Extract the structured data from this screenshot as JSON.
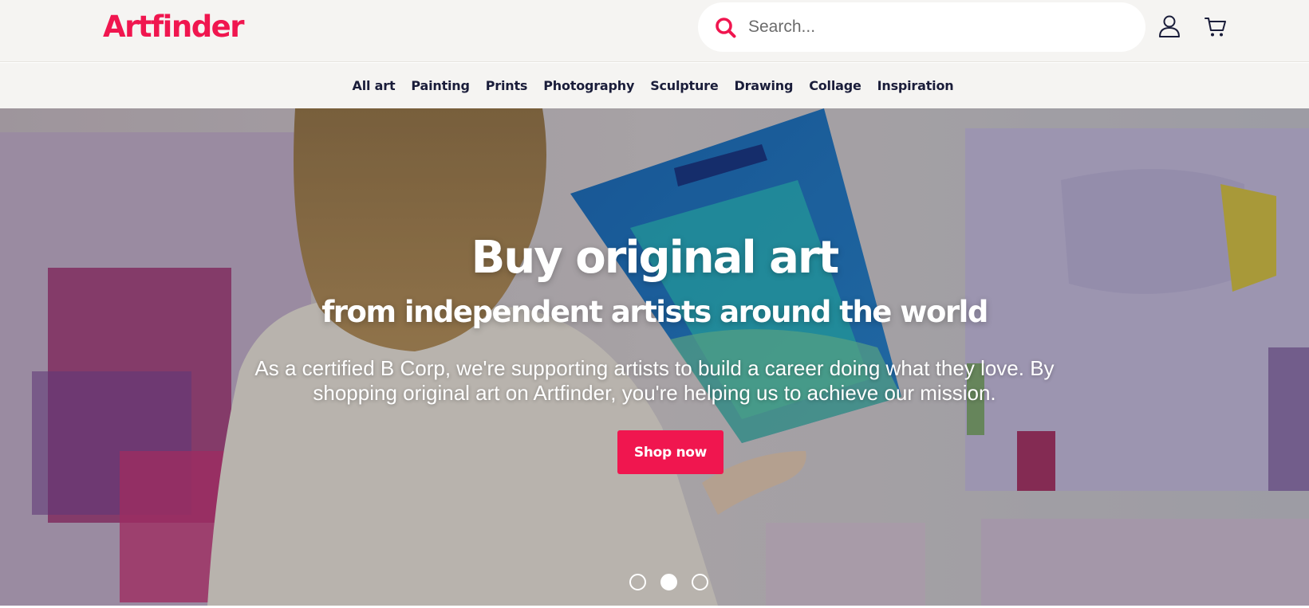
{
  "header": {
    "logo_text": "Artfinder",
    "search_placeholder": "Search...",
    "search_icon": "search-icon",
    "account_icon": "user-icon",
    "cart_icon": "cart-icon"
  },
  "nav": {
    "items": [
      "All art",
      "Painting",
      "Prints",
      "Photography",
      "Sculpture",
      "Drawing",
      "Collage",
      "Inspiration"
    ]
  },
  "hero": {
    "title": "Buy original art",
    "subtitle": "from independent artists around the world",
    "body": "As a certified B Corp, we're supporting artists to build a career doing what they love. By shopping original art on Artfinder, you're helping us to achieve our mission.",
    "cta_label": "Shop now",
    "slides": {
      "count": 3,
      "active_index": 1
    }
  },
  "colors": {
    "brand": "#f0164f",
    "header_bg": "#f5f4f2",
    "nav_text": "#1a1d3a"
  }
}
